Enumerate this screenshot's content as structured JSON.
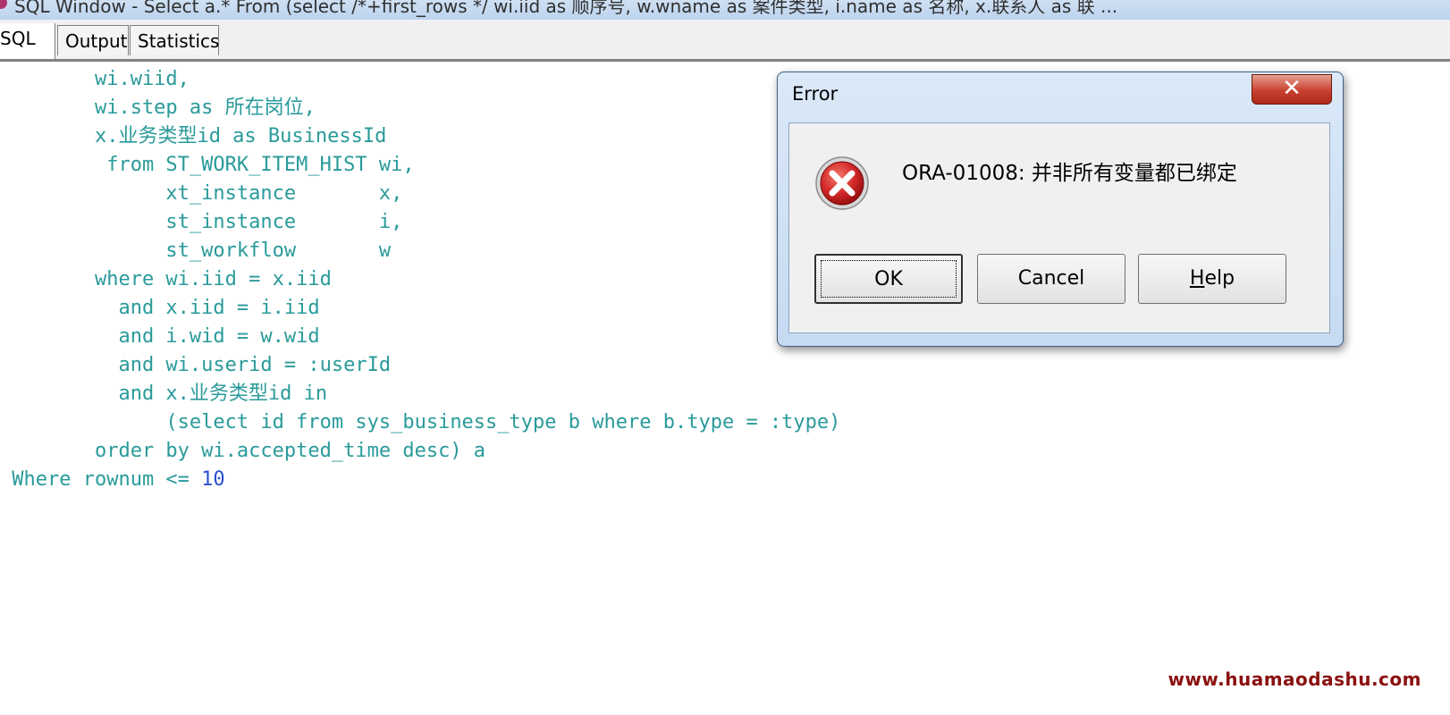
{
  "window": {
    "title": "SQL Window - Select a.* From (select /*+first_rows */ wi.iid as 顺序号, w.wname as 案件类型, i.name as 名称, x.联系人 as 联 ..."
  },
  "tabs": [
    {
      "label": "SQL",
      "active": true
    },
    {
      "label": "Output",
      "active": false
    },
    {
      "label": "Statistics",
      "active": false
    }
  ],
  "editor": {
    "lines": [
      "        wi.wiid,",
      "        wi.step as 所在岗位,",
      "        x.业务类型id as BusinessId",
      "         from ST_WORK_ITEM_HIST wi,",
      "              xt_instance       x,",
      "              st_instance       i,",
      "              st_workflow       w",
      "        where wi.iid = x.iid",
      "          and x.iid = i.iid",
      "          and i.wid = w.wid",
      "          and wi.userid = :userId",
      "          and x.业务类型id in",
      "              (select id from sys_business_type b where b.type = :type)",
      "        order by wi.accepted_time desc) a",
      " Where rownum <= ",
      "10"
    ]
  },
  "dialog": {
    "title": "Error",
    "message": "ORA-01008: 并非所有变量都已绑定",
    "ok_label": "OK",
    "cancel_label": "Cancel",
    "help_first": "H",
    "help_rest": "elp",
    "close_glyph": "✕"
  },
  "watermark": "www.huamaodashu.com",
  "colors": {
    "code_text": "#2a9a9a",
    "number_literal": "#2a4fd0",
    "error_icon": "#d42a2a",
    "watermark": "#8b1010"
  }
}
